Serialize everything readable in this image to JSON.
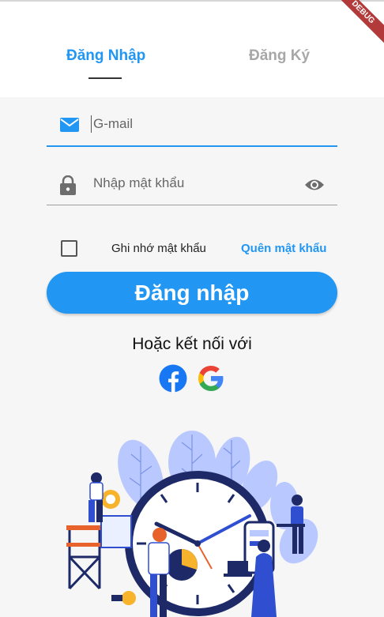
{
  "banner": {
    "text": "DEBUG"
  },
  "tabs": [
    {
      "label": "Đăng Nhập",
      "active": true
    },
    {
      "label": "Đăng Ký",
      "active": false
    }
  ],
  "email": {
    "placeholder": "G-mail",
    "value": "",
    "icon": "mail-icon"
  },
  "password": {
    "placeholder": "Nhập mật khẩu",
    "value": "",
    "icon": "lock-icon",
    "toggle_icon": "eye-icon"
  },
  "remember": {
    "label": "Ghi nhớ mật khẩu",
    "checked": false
  },
  "forgot": {
    "label": "Quên mật khẩu"
  },
  "login_button": {
    "label": "Đăng nhập"
  },
  "social": {
    "heading": "Hoặc kết nối với",
    "icons": [
      "facebook-icon",
      "google-icon"
    ]
  },
  "colors": {
    "accent": "#2196f3",
    "inactive_tab": "#a7a7a7",
    "background": "#f6f6f6"
  }
}
